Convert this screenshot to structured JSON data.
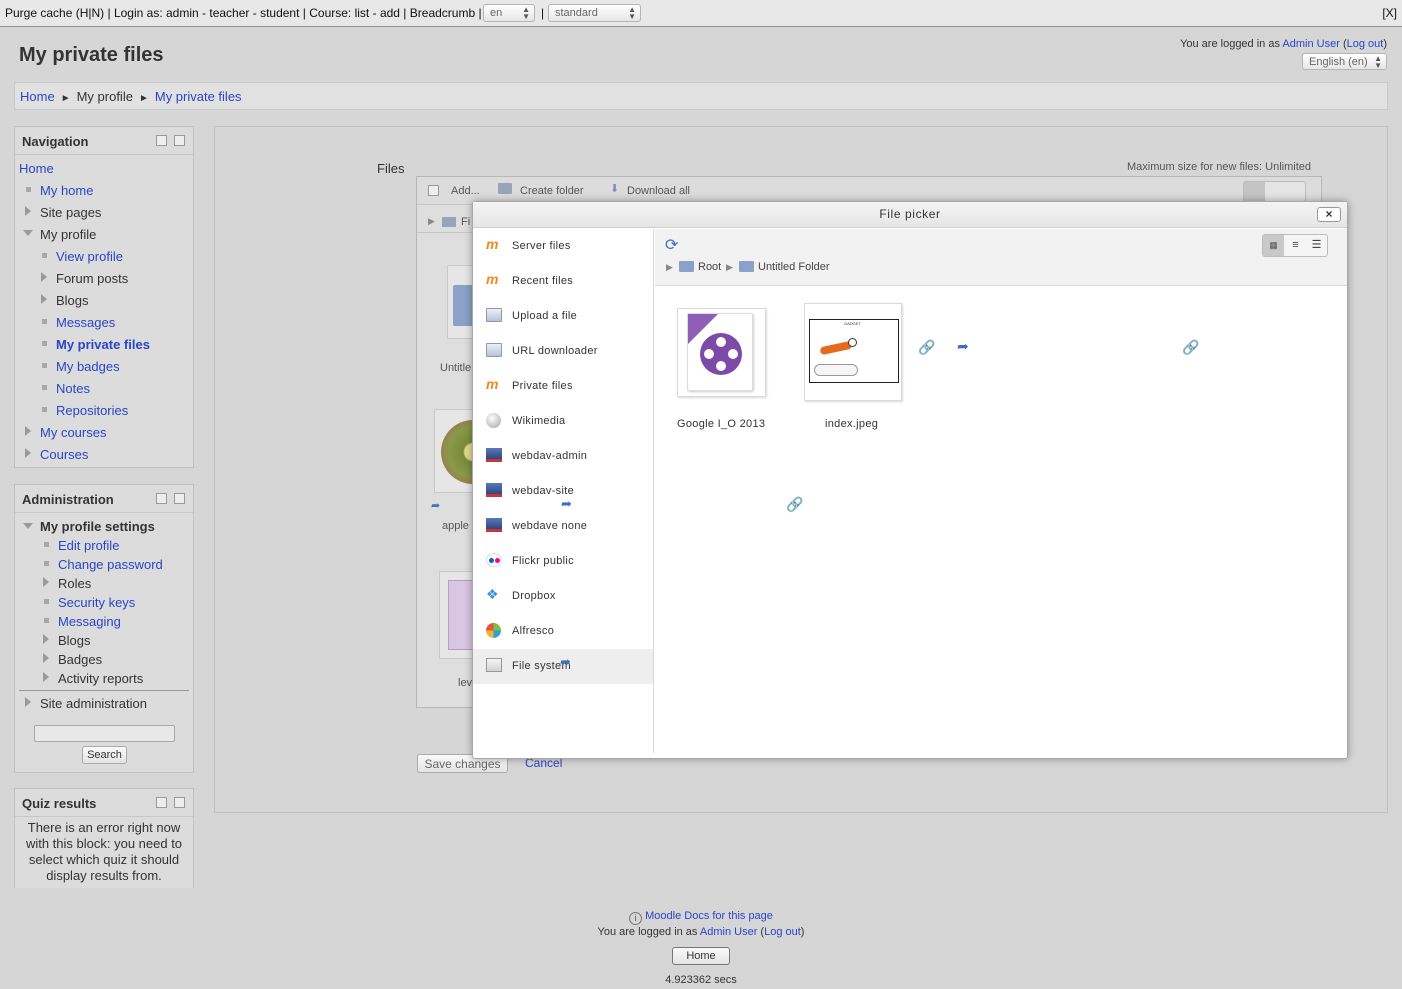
{
  "devbar": {
    "purge": "Purge cache (H|N)",
    "login_as": "| Login as:",
    "roles": [
      "admin",
      "teacher",
      "student"
    ],
    "course_label": "| Course:",
    "course_links": [
      "list",
      "add"
    ],
    "breadcrumb_link": "Breadcrumb",
    "lang_select": "en",
    "theme_select": "standard",
    "close": "[X]"
  },
  "header": {
    "title": "My private files",
    "logged_in_prefix": "You are logged in as",
    "user": "Admin User",
    "logout": "Log out",
    "language": "English (en)"
  },
  "breadcrumb": [
    "Home",
    "My profile",
    "My private files"
  ],
  "navigation": {
    "title": "Navigation",
    "items": [
      {
        "label": "Home"
      },
      {
        "label": "My home"
      },
      {
        "label": "Site pages"
      },
      {
        "label": "My profile"
      },
      {
        "label": "View profile"
      },
      {
        "label": "Forum posts"
      },
      {
        "label": "Blogs"
      },
      {
        "label": "Messages"
      },
      {
        "label": "My private files"
      },
      {
        "label": "My badges"
      },
      {
        "label": "Notes"
      },
      {
        "label": "Repositories"
      },
      {
        "label": "My courses"
      },
      {
        "label": "Courses"
      }
    ]
  },
  "administration": {
    "title": "Administration",
    "section": "My profile settings",
    "items": [
      "Edit profile",
      "Change password",
      "Roles",
      "Security keys",
      "Messaging",
      "Blogs",
      "Badges",
      "Activity reports"
    ],
    "site_admin": "Site administration",
    "search_button": "Search"
  },
  "quiz": {
    "title": "Quiz results",
    "message": "There is an error right now with this block: you need to select which quiz it should display results from."
  },
  "files": {
    "label": "Files",
    "max_size": "Maximum size for new files: Unlimited",
    "add": "Add...",
    "create_folder": "Create folder",
    "download_all": "Download all",
    "path_partial": "Fi",
    "partial_names": [
      "Untitle",
      "apple",
      "lev"
    ],
    "save": "Save changes",
    "cancel": "Cancel"
  },
  "picker": {
    "title": "File picker",
    "close": "×",
    "repos": [
      "Server files",
      "Recent files",
      "Upload a file",
      "URL downloader",
      "Private files",
      "Wikimedia",
      "webdav-admin",
      "webdav-site",
      "webdave none",
      "Flickr public",
      "Dropbox",
      "Alfresco",
      "File system"
    ],
    "path": [
      "Root",
      "Untitled Folder"
    ],
    "files": [
      "Google I_O 2013",
      "index.jpeg"
    ],
    "thumb_caption": "GADGET"
  },
  "footer": {
    "docs": "Moodle Docs for this page",
    "logged_prefix": "You are logged in as",
    "user": "Admin User",
    "logout": "Log out",
    "home": "Home",
    "timing": "4.923362 secs"
  }
}
